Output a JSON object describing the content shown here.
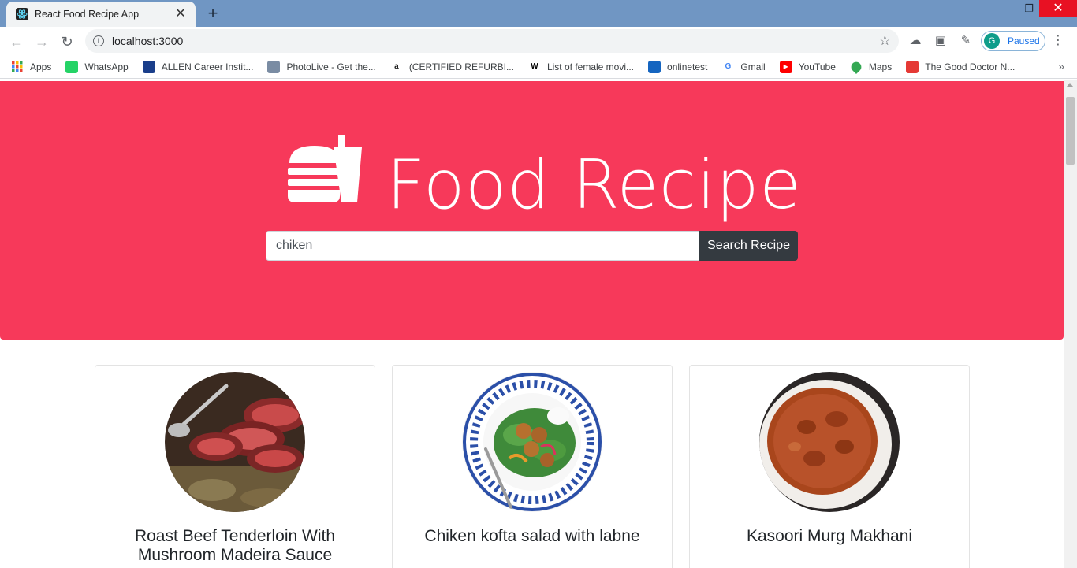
{
  "browser": {
    "tab": {
      "title": "React Food Recipe App"
    },
    "address": {
      "url": "localhost:3000"
    },
    "profile": {
      "initial": "G",
      "status": "Paused"
    },
    "bookmarks": [
      {
        "label": "Apps",
        "icon": "apps-grid-icon",
        "color": "#ea4335"
      },
      {
        "label": "WhatsApp",
        "icon": "whatsapp-icon",
        "color": "#25d366"
      },
      {
        "label": "ALLEN Career Instit...",
        "icon": "allen-icon",
        "color": "#1a3e8a"
      },
      {
        "label": "PhotoLive - Get the...",
        "icon": "photolive-icon",
        "color": "#7a8ca3"
      },
      {
        "label": "(CERTIFIED REFURBI...",
        "icon": "amazon-icon",
        "color": "#222222"
      },
      {
        "label": "List of female movi...",
        "icon": "wikipedia-icon",
        "color": "#ffffff"
      },
      {
        "label": "onlinetest",
        "icon": "onlinetest-icon",
        "color": "#1565c0"
      },
      {
        "label": "Gmail",
        "icon": "google-icon",
        "color": "#ffffff"
      },
      {
        "label": "YouTube",
        "icon": "youtube-icon",
        "color": "#ff0000"
      },
      {
        "label": "Maps",
        "icon": "maps-icon",
        "color": "#34a853"
      },
      {
        "label": "The Good Doctor N...",
        "icon": "calendar-date-icon",
        "color": "#e53935"
      }
    ]
  },
  "hero": {
    "title": "Food Recipe",
    "background": "#f7395a"
  },
  "search": {
    "value": "chiken",
    "button_label": "Search Recipe"
  },
  "recipes": [
    {
      "title": "Roast Beef Tenderloin With Mushroom Madeira Sauce",
      "image": "roast-beef-image"
    },
    {
      "title": "Chiken kofta salad with labne",
      "image": "kofta-salad-image"
    },
    {
      "title": "Kasoori Murg Makhani",
      "image": "murg-makhani-image"
    }
  ]
}
